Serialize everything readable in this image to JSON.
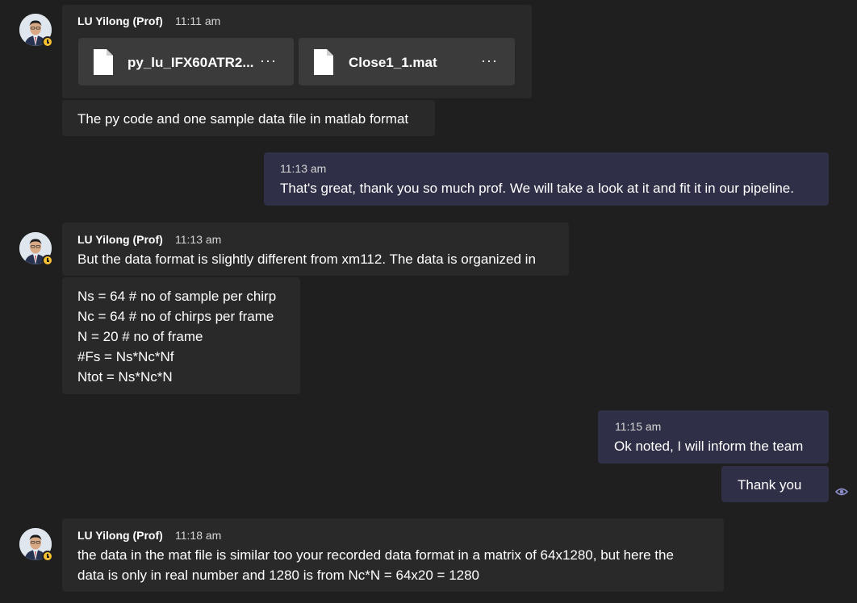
{
  "colors": {
    "background": "#1f1f1f",
    "incoming_bubble": "#292929",
    "outgoing_bubble": "#2f3047",
    "file_card": "#3b3b3b",
    "status_away": "#f8c032",
    "seen_accent": "#8b8cc7"
  },
  "messages": {
    "m1": {
      "sender": "LU Yilong (Prof)",
      "time": "11:11 am",
      "files": [
        {
          "name": "py_lu_IFX60ATR2...",
          "icon": "file-icon",
          "more": "···"
        },
        {
          "name": "Close1_1.mat",
          "icon": "file-icon",
          "more": "···"
        }
      ],
      "text": "The py code and one sample data file in matlab format"
    },
    "m2": {
      "time": "11:13 am",
      "text": "That's great, thank you so much prof. We will take a look at it and fit it in our pipeline."
    },
    "m3": {
      "sender": "LU Yilong (Prof)",
      "time": "11:13 am",
      "text": "But the data format is slightly different from xm112. The data is organized in",
      "code_lines": [
        "Ns = 64 # no of sample per chirp",
        "Nc = 64 # no of chirps per frame",
        "N = 20 # no of frame",
        "#Fs = Ns*Nc*Nf",
        "Ntot = Ns*Nc*N"
      ]
    },
    "m4": {
      "time": "11:15 am",
      "text": "Ok noted, I will inform the team",
      "followup": "Thank you",
      "seen_icon": "eye-icon"
    },
    "m5": {
      "sender": "LU Yilong (Prof)",
      "time": "11:18 am",
      "lines": [
        "the data in the mat file is similar too your recorded data format in a matrix of 64x1280, but here the",
        "data is only in real number and 1280 is from Nc*N = 64x20 = 1280"
      ]
    }
  }
}
